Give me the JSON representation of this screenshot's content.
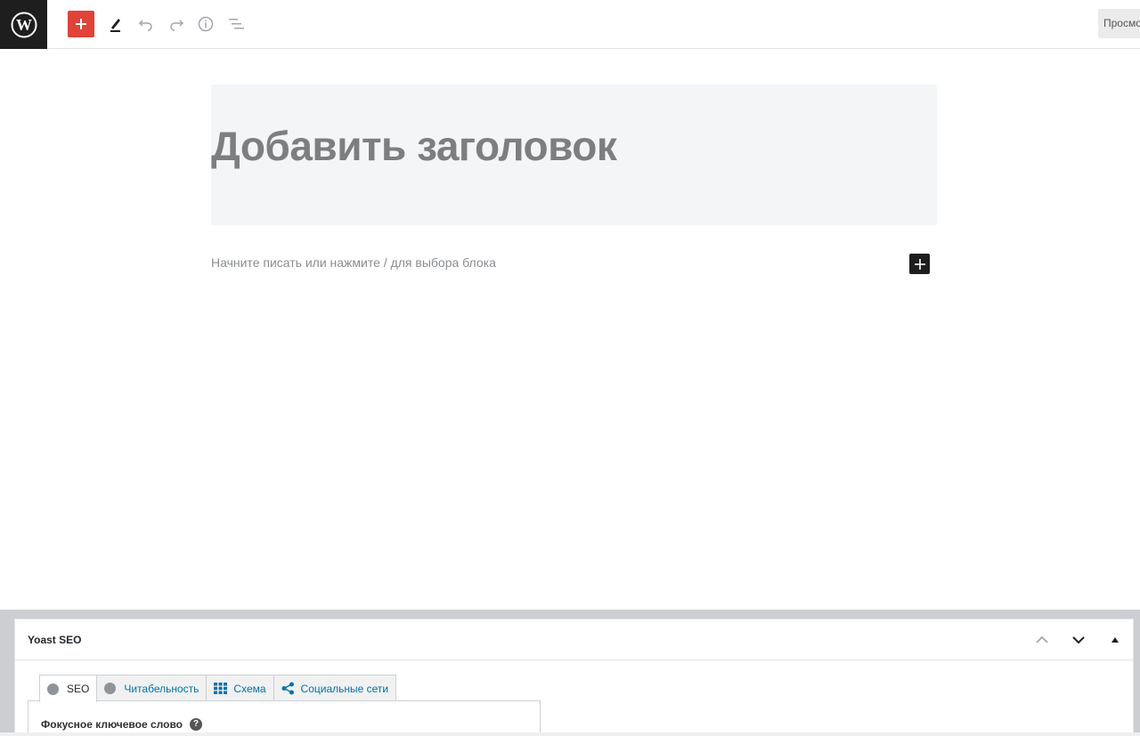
{
  "toolbar": {
    "logo_icon": "wordpress-logo-icon",
    "add_block_icon": "plus-icon",
    "tools_icon": "pencil-icon",
    "undo_icon": "undo-icon",
    "redo_icon": "redo-icon",
    "info_icon": "info-icon",
    "outline_icon": "list-view-icon",
    "preview_label": "Просмотр",
    "accent_color": "#e04337"
  },
  "editor": {
    "title_placeholder": "Добавить заголовок",
    "block_placeholder": "Начните писать или нажмите / для выбора блока"
  },
  "metabox": {
    "title": "Yoast SEO",
    "controls": [
      "chevron-up-icon",
      "chevron-down-icon",
      "triangle-up-icon"
    ],
    "tabs": [
      {
        "label": "SEO",
        "icon": "status-dot-icon",
        "active": true
      },
      {
        "label": "Читабельность",
        "icon": "status-dot-icon",
        "active": false
      },
      {
        "label": "Схема",
        "icon": "grid-icon",
        "active": false
      },
      {
        "label": "Социальные сети",
        "icon": "share-icon",
        "active": false
      }
    ],
    "focus_keyword_label": "Фокусное ключевое слово",
    "help_glyph": "?"
  }
}
